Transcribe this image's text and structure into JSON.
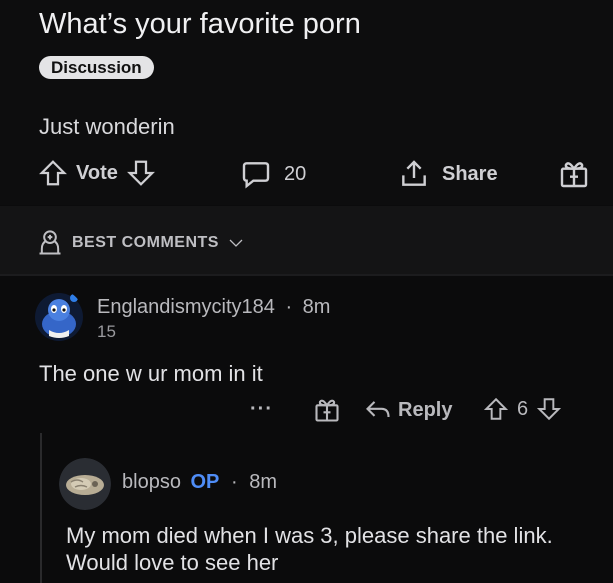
{
  "post": {
    "title": "What’s your favorite porn",
    "flair": "Discussion",
    "body": "Just wonderin",
    "vote_label": "Vote",
    "comment_count": "20",
    "share_label": "Share"
  },
  "sort": {
    "label": "BEST COMMENTS"
  },
  "comments": [
    {
      "username": "Englandismycity184",
      "separator": "·",
      "age": "8m",
      "score": "15",
      "body": "The one w ur mom in it",
      "more": "···",
      "reply_label": "Reply",
      "votes": "6"
    },
    {
      "username": "blopso",
      "op_badge": "OP",
      "separator": "·",
      "age": "8m",
      "body": "My mom died when I was 3, please share the link. Would love to see her"
    }
  ],
  "colors": {
    "background": "#0b0b0c",
    "op_badge": "#4f8df7",
    "flair_bg": "#e4e4e6"
  },
  "icons": [
    "upvote-icon",
    "downvote-icon",
    "comment-icon",
    "share-icon",
    "award-icon",
    "trophy-icon",
    "chevron-down-icon",
    "more-icon",
    "reply-icon"
  ]
}
